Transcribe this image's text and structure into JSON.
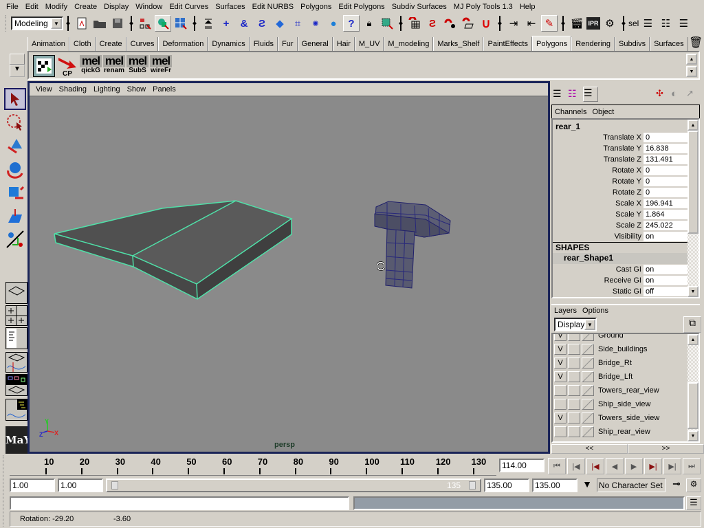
{
  "menubar": [
    "File",
    "Edit",
    "Modify",
    "Create",
    "Display",
    "Window",
    "Edit Curves",
    "Surfaces",
    "Edit NURBS",
    "Polygons",
    "Edit Polygons",
    "Subdiv Surfaces",
    "MJ Poly Tools 1.3",
    "Help"
  ],
  "statusline": {
    "mode_selector": "Modeling",
    "sel_label": "sel"
  },
  "shelf_tabs": [
    "Animation",
    "Cloth",
    "Create",
    "Curves",
    "Deformation",
    "Dynamics",
    "Fluids",
    "Fur",
    "General",
    "Hair",
    "M_UV",
    "M_modeling",
    "Marks_Shelf",
    "PaintEffects",
    "Polygons",
    "Rendering",
    "Subdivs",
    "Surfaces"
  ],
  "active_shelf_tab": "Polygons",
  "shelf_buttons": [
    {
      "icon": "checker-uv-icon",
      "label": ""
    },
    {
      "icon": "red-arrow-icon",
      "label": "CP"
    },
    {
      "icon": "mel",
      "label": "qickG"
    },
    {
      "icon": "mel",
      "label": "renam"
    },
    {
      "icon": "mel",
      "label": "SubS"
    },
    {
      "icon": "mel",
      "label": "wireFr"
    }
  ],
  "mel_text": "mel",
  "viewport": {
    "menu": [
      "View",
      "Shading",
      "Lighting",
      "Show",
      "Panels"
    ],
    "camera_label": "persp",
    "axis": {
      "x": "X",
      "y": "Y",
      "z": "Z"
    }
  },
  "channel_box": {
    "menu": [
      "Channels",
      "Object"
    ],
    "object_name": "rear_1",
    "attributes": [
      {
        "label": "Translate X",
        "value": "0"
      },
      {
        "label": "Translate Y",
        "value": "16.838"
      },
      {
        "label": "Translate Z",
        "value": "131.491"
      },
      {
        "label": "Rotate X",
        "value": "0"
      },
      {
        "label": "Rotate Y",
        "value": "0"
      },
      {
        "label": "Rotate Z",
        "value": "0"
      },
      {
        "label": "Scale X",
        "value": "196.941"
      },
      {
        "label": "Scale Y",
        "value": "1.864"
      },
      {
        "label": "Scale Z",
        "value": "245.022"
      },
      {
        "label": "Visibility",
        "value": "on"
      }
    ],
    "shapes_header": "SHAPES",
    "shape_name": "rear_Shape1",
    "shape_attributes": [
      {
        "label": "Cast GI",
        "value": "on"
      },
      {
        "label": "Receive GI",
        "value": "on"
      },
      {
        "label": "Static GI",
        "value": "off"
      }
    ]
  },
  "layers": {
    "menu": [
      "Layers",
      "Options"
    ],
    "display_select": "Display",
    "items": [
      {
        "name": "Ground",
        "visible": "V"
      },
      {
        "name": "Side_buildings",
        "visible": "V"
      },
      {
        "name": "Bridge_Rt",
        "visible": "V"
      },
      {
        "name": "Bridge_Lft",
        "visible": "V"
      },
      {
        "name": "Towers_rear_view",
        "visible": ""
      },
      {
        "name": "Ship_side_view",
        "visible": ""
      },
      {
        "name": "Towers_side_view",
        "visible": "V"
      },
      {
        "name": "Ship_rear_view",
        "visible": ""
      }
    ],
    "nav_prev": "<<",
    "nav_next": ">>"
  },
  "timeline": {
    "ticks": [
      "10",
      "20",
      "30",
      "40",
      "50",
      "60",
      "70",
      "80",
      "90",
      "100",
      "110",
      "120",
      "130"
    ],
    "current_time": "114.00",
    "range_start": "1.00",
    "playback_start": "1.00",
    "range_slider_end_label": "135",
    "playback_end": "135.00",
    "range_end": "135.00",
    "character_set": "No Character Set"
  },
  "help_line": {
    "rotation_label": "Rotation: -29.20",
    "rotation_extra": "-3.60"
  },
  "colors": {
    "selection_wire": "#4fe0a8",
    "viewport_bg": "#8a8a8a",
    "panel_border": "#1a2458"
  }
}
